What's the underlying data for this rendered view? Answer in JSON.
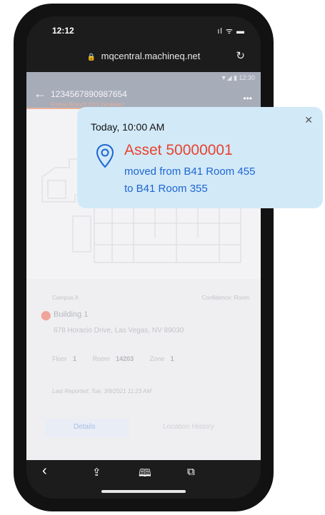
{
  "status_bar": {
    "time": "12:12",
    "icons": "ıl ᯤ ▬"
  },
  "browser": {
    "url": "mqcentral.machineq.net",
    "lock_icon": "lock-icon",
    "reload_glyph": "↻"
  },
  "app": {
    "inner_status": "▼◢ ▮ 12:30",
    "back_glyph": "←",
    "asset_id": "1234567890987654",
    "subtitle": "Forma Branch Ch3 Incubator",
    "more_glyph": "•••",
    "accent_color": "#eab39a"
  },
  "location_card": {
    "campus": "Campus A",
    "confidence": "Confidence: Room",
    "building": "Building 1",
    "address": "678 Horacio Drive, Las Vegas, NV 89030",
    "floor_label": "Floor",
    "floor_value": "1",
    "room_label": "Room",
    "room_value": "14203",
    "zone_label": "Zone",
    "zone_value": "1",
    "last_reported": "Last Reported: Tue, 3/9/2021 11:23 AM"
  },
  "tabs": {
    "details": "Details",
    "history": "Location History"
  },
  "toolbar": {
    "back": "‹",
    "share": "⇪",
    "bookmarks": "🕮",
    "tabs": "⧉"
  },
  "notification": {
    "timestamp": "Today, 10:00 AM",
    "asset": "Asset 50000001",
    "message_line1": "moved from B41 Room 455",
    "message_line2": "to B41 Room 355",
    "close_glyph": "✕",
    "asset_color": "#e8432e",
    "message_color": "#1e66d2",
    "background": "#d2e9f8"
  }
}
